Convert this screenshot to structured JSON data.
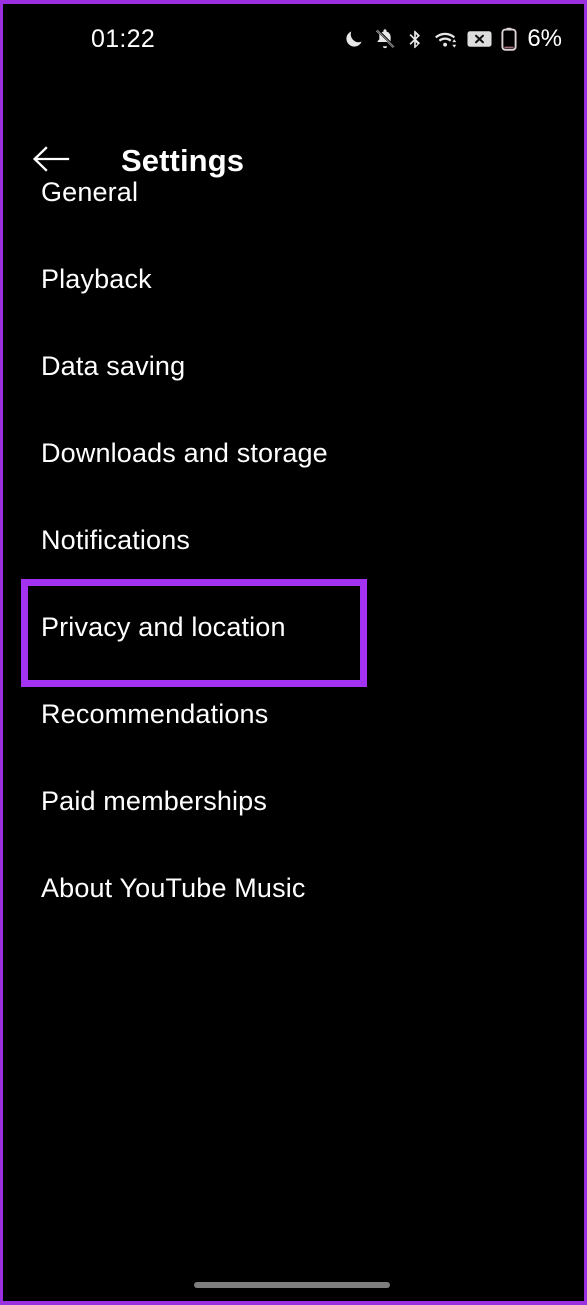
{
  "status_bar": {
    "clock": "01:22",
    "battery_percent": "6%",
    "icons": [
      {
        "name": "do-not-disturb-moon-icon",
        "label": "Do not disturb"
      },
      {
        "name": "bell-muted-icon",
        "label": "Notifications silenced"
      },
      {
        "name": "bluetooth-icon",
        "label": "Bluetooth"
      },
      {
        "name": "wifi-icon",
        "label": "Wi-Fi"
      },
      {
        "name": "no-sim-x-icon",
        "label": "No SIM"
      },
      {
        "name": "battery-low-icon",
        "label": "Battery low"
      }
    ]
  },
  "app_bar": {
    "back_label": "Back",
    "title": "Settings"
  },
  "settings": {
    "items": [
      {
        "label": "General",
        "highlighted": false
      },
      {
        "label": "Playback",
        "highlighted": false
      },
      {
        "label": "Data saving",
        "highlighted": false
      },
      {
        "label": "Downloads and storage",
        "highlighted": false
      },
      {
        "label": "Notifications",
        "highlighted": false
      },
      {
        "label": "Privacy and location",
        "highlighted": true
      },
      {
        "label": "Recommendations",
        "highlighted": false
      },
      {
        "label": "Paid memberships",
        "highlighted": false
      },
      {
        "label": "About YouTube Music",
        "highlighted": false
      }
    ]
  },
  "nav_bar": {
    "home_indicator_label": "Home gesture bar"
  },
  "colors": {
    "background": "#000000",
    "text_primary": "#ffffff",
    "highlight_purple": "#a333f0",
    "frame_purple": "#9b30e0",
    "home_indicator": "#7d7d7d"
  }
}
